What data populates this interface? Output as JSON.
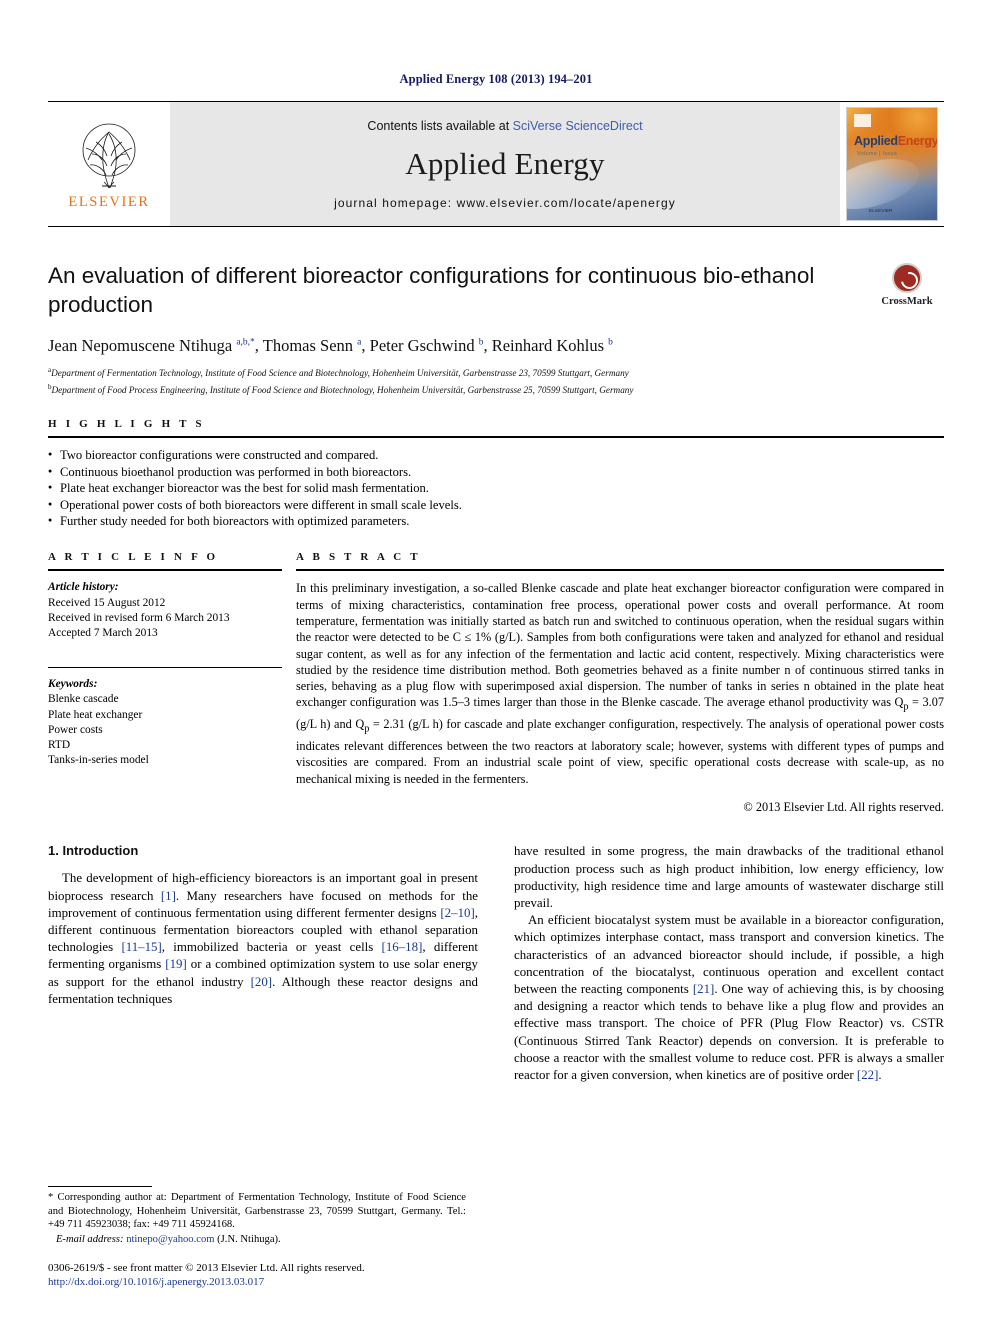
{
  "running_head": "Applied Energy 108 (2013) 194–201",
  "masthead": {
    "publisher": "ELSEVIER",
    "contents_prefix": "Contents lists available at ",
    "contents_link": "SciVerse ScienceDirect",
    "journal_name": "Applied Energy",
    "homepage": "journal homepage: www.elsevier.com/locate/apenergy",
    "cover": {
      "title_a": "Applied",
      "title_b": "Energy",
      "subtitle": "Volume | Issue",
      "footer": "ELSEVIER"
    }
  },
  "article": {
    "title": "An evaluation of different bioreactor configurations for continuous bio-ethanol production",
    "crossmark_label": "CrossMark",
    "authors_html": "Jean Nepomuscene Ntihuga <sup>a,b,</sup><sup>*</sup>, Thomas Senn <sup>a</sup>, Peter Gschwind <sup>b</sup>, Reinhard Kohlus <sup>b</sup>",
    "affiliations": [
      "Department of Fermentation Technology, Institute of Food Science and Biotechnology, Hohenheim Universität, Garbenstrasse 23, 70599 Stuttgart, Germany",
      "Department of Food Process Engineering, Institute of Food Science and Biotechnology, Hohenheim Universität, Garbenstrasse 25, 70599 Stuttgart, Germany"
    ],
    "affiliation_marks": [
      "a",
      "b"
    ]
  },
  "highlights": {
    "heading": "H I G H L I G H T S",
    "items": [
      "Two bioreactor configurations were constructed and compared.",
      "Continuous bioethanol production was performed in both bioreactors.",
      "Plate heat exchanger bioreactor was the best for solid mash fermentation.",
      "Operational power costs of both bioreactors were different in small scale levels.",
      "Further study needed for both bioreactors with optimized parameters."
    ]
  },
  "article_info": {
    "heading": "A R T I C L E    I N F O",
    "history_label": "Article history:",
    "history": [
      "Received 15 August 2012",
      "Received in revised form 6 March 2013",
      "Accepted 7 March 2013"
    ],
    "keywords_label": "Keywords:",
    "keywords": [
      "Blenke cascade",
      "Plate heat exchanger",
      "Power costs",
      "RTD",
      "Tanks-in-series model"
    ]
  },
  "abstract": {
    "heading": "A B S T R A C T",
    "text": "In this preliminary investigation, a so-called Blenke cascade and plate heat exchanger bioreactor configuration were compared in terms of mixing characteristics, contamination free process, operational power costs and overall performance. At room temperature, fermentation was initially started as batch run and switched to continuous operation, when the residual sugars within the reactor were detected to be C ≤ 1% (g/L). Samples from both configurations were taken and analyzed for ethanol and residual sugar content, as well as for any infection of the fermentation and lactic acid content, respectively. Mixing characteristics were studied by the residence time distribution method. Both geometries behaved as a finite number n of continuous stirred tanks in series, behaving as a plug flow with superimposed axial dispersion. The number of tanks in series n obtained in the plate heat exchanger configuration was 1.5–3 times larger than those in the Blenke cascade. The average ethanol productivity was Qp = 3.07 (g/L h) and Qp = 2.31 (g/L h) for cascade and plate exchanger configuration, respectively. The analysis of operational power costs indicates relevant differences between the two reactors at laboratory scale; however, systems with different types of pumps and viscosities are compared. From an industrial scale point of view, specific operational costs decrease with scale-up, as no mechanical mixing is needed in the fermenters.",
    "copyright": "© 2013 Elsevier Ltd. All rights reserved."
  },
  "body": {
    "section_heading": "1. Introduction",
    "left_paragraph": "The development of high-efficiency bioreactors is an important goal in present bioprocess research [1]. Many researchers have focused on methods for the improvement of continuous fermentation using different fermenter designs [2–10], different continuous fermentation bioreactors coupled with ethanol separation technologies [11–15], immobilized bacteria or yeast cells [16–18], different fermenting organisms [19] or a combined optimization system to use solar energy as support for the ethanol industry [20]. Although these reactor designs and fermentation techniques",
    "right_paragraph_1": "have resulted in some progress, the main drawbacks of the traditional ethanol production process such as high product inhibition, low energy efficiency, low productivity, high residence time and large amounts of wastewater discharge still prevail.",
    "right_paragraph_2": "An efficient biocatalyst system must be available in a bioreactor configuration, which optimizes interphase contact, mass transport and conversion kinetics. The characteristics of an advanced bioreactor should include, if possible, a high concentration of the biocatalyst, continuous operation and excellent contact between the reacting components [21]. One way of achieving this, is by choosing and designing a reactor which tends to behave like a plug flow and provides an effective mass transport. The choice of PFR (Plug Flow Reactor) vs. CSTR (Continuous Stirred Tank Reactor) depends on conversion. It is preferable to choose a reactor with the smallest volume to reduce cost. PFR is always a smaller reactor for a given conversion, when kinetics are of positive order [22]."
  },
  "footnotes": {
    "corresponding": "* Corresponding author at: Department of Fermentation Technology, Institute of Food Science and Biotechnology, Hohenheim Universität, Garbenstrasse 23, 70599 Stuttgart, Germany. Tel.: +49 711 45923038; fax: +49 711 45924168.",
    "email_label": "E-mail address:",
    "email": "ntinepo@yahoo.com",
    "email_suffix": "(J.N. Ntihuga).",
    "issn_line": "0306-2619/$ - see front matter © 2013 Elsevier Ltd. All rights reserved.",
    "doi": "http://dx.doi.org/10.1016/j.apenergy.2013.03.017"
  }
}
